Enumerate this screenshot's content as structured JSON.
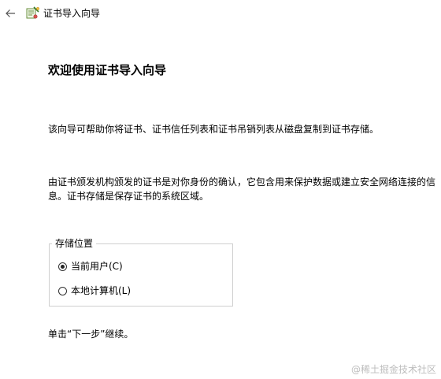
{
  "titlebar": {
    "title": "证书导入向导",
    "back_icon": "back-arrow-icon",
    "app_icon": "certificate-wizard-icon"
  },
  "heading": "欢迎使用证书导入向导",
  "paragraphs": {
    "intro": "该向导可帮助你将证书、证书信任列表和证书吊销列表从磁盘复制到证书存储。",
    "description": "由证书颁发机构颁发的证书是对你身份的确认，它包含用来保护数据或建立安全网络连接的信息。证书存储是保存证书的系统区域。",
    "instruction": "单击“下一步”继续。"
  },
  "store_location": {
    "label": "存储位置",
    "options": [
      {
        "label": "当前用户(C)",
        "checked": true
      },
      {
        "label": "本地计算机(L)",
        "checked": false
      }
    ]
  },
  "watermark": "@稀土掘金技术社区",
  "colors": {
    "background": "#ffffff",
    "text": "#000000",
    "groupbox_border": "#cfcfcf",
    "watermark": "#bdbdbd"
  }
}
